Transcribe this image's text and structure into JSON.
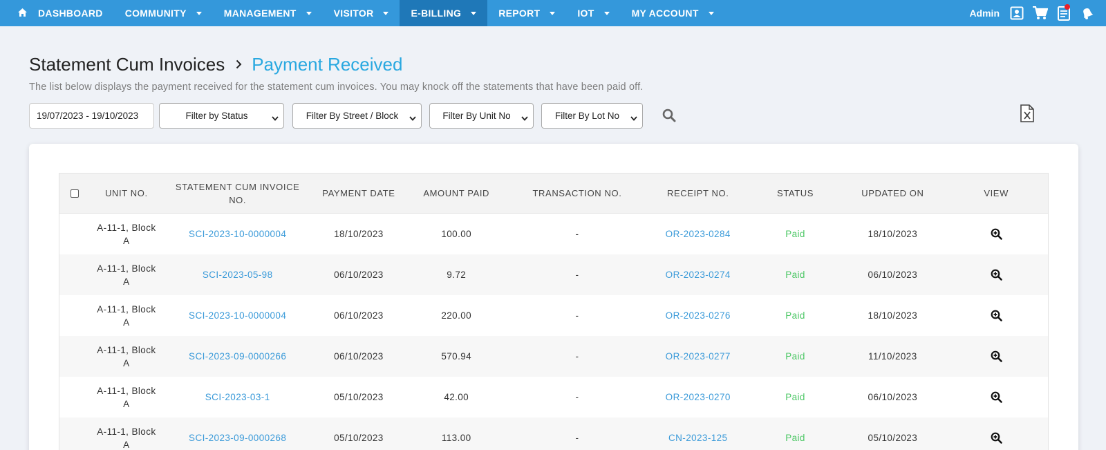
{
  "nav": {
    "items": [
      {
        "label": "DASHBOARD",
        "icon": "home-icon"
      },
      {
        "label": "COMMUNITY"
      },
      {
        "label": "MANAGEMENT"
      },
      {
        "label": "VISITOR"
      },
      {
        "label": "E-BILLING",
        "active": true
      },
      {
        "label": "REPORT"
      },
      {
        "label": "IOT"
      },
      {
        "label": "MY ACCOUNT"
      }
    ],
    "user_label": "Admin",
    "accent_color": "#3498db",
    "active_color": "#1f78b8"
  },
  "breadcrumb": {
    "parent": "Statement Cum Invoices",
    "current": "Payment Received"
  },
  "subtitle": "The list below displays the payment received for the statement cum invoices. You may knock off the statements that have been paid off.",
  "filters": {
    "date_range": "19/07/2023 - 19/10/2023",
    "status": "Filter by Status",
    "street_block": "Filter By Street / Block",
    "unit_no": "Filter By Unit No",
    "lot_no": "Filter By Lot No"
  },
  "table": {
    "headers": {
      "unit_no": "UNIT NO.",
      "sci_no": "STATEMENT CUM INVOICE NO.",
      "payment_date": "PAYMENT DATE",
      "amount_paid": "AMOUNT PAID",
      "transaction_no": "TRANSACTION NO.",
      "receipt_no": "RECEIPT NO.",
      "status": "STATUS",
      "updated_on": "UPDATED ON",
      "view": "VIEW"
    },
    "rows": [
      {
        "unit": "A-11-1, Block A",
        "sci": "SCI-2023-10-0000004",
        "payment_date": "18/10/2023",
        "amount": "100.00",
        "txn": "-",
        "receipt": "OR-2023-0284",
        "status": "Paid",
        "updated": "18/10/2023"
      },
      {
        "unit": "A-11-1, Block A",
        "sci": "SCI-2023-05-98",
        "payment_date": "06/10/2023",
        "amount": "9.72",
        "txn": "-",
        "receipt": "OR-2023-0274",
        "status": "Paid",
        "updated": "06/10/2023"
      },
      {
        "unit": "A-11-1, Block A",
        "sci": "SCI-2023-10-0000004",
        "payment_date": "06/10/2023",
        "amount": "220.00",
        "txn": "-",
        "receipt": "OR-2023-0276",
        "status": "Paid",
        "updated": "18/10/2023"
      },
      {
        "unit": "A-11-1, Block A",
        "sci": "SCI-2023-09-0000266",
        "payment_date": "06/10/2023",
        "amount": "570.94",
        "txn": "-",
        "receipt": "OR-2023-0277",
        "status": "Paid",
        "updated": "11/10/2023"
      },
      {
        "unit": "A-11-1, Block A",
        "sci": "SCI-2023-03-1",
        "payment_date": "05/10/2023",
        "amount": "42.00",
        "txn": "-",
        "receipt": "OR-2023-0270",
        "status": "Paid",
        "updated": "06/10/2023"
      },
      {
        "unit": "A-11-1, Block A",
        "sci": "SCI-2023-09-0000268",
        "payment_date": "05/10/2023",
        "amount": "113.00",
        "txn": "-",
        "receipt": "CN-2023-125",
        "status": "Paid",
        "updated": "05/10/2023"
      }
    ],
    "link_color": "#3a9ad9",
    "paid_color": "#4cc765"
  }
}
